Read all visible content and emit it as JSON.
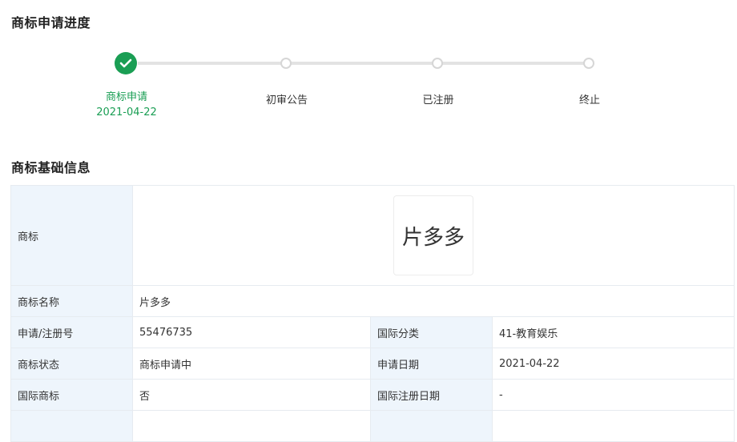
{
  "progress": {
    "title": "商标申请进度",
    "steps": [
      {
        "label": "商标申请",
        "date": "2021-04-22",
        "status": "done"
      },
      {
        "label": "初审公告",
        "date": "",
        "status": "pending"
      },
      {
        "label": "已注册",
        "date": "",
        "status": "pending"
      },
      {
        "label": "终止",
        "date": "",
        "status": "pending"
      }
    ]
  },
  "info": {
    "title": "商标基础信息",
    "trademark_label": "商标",
    "trademark_image_text": "片多多",
    "name_label": "商标名称",
    "name_value": "片多多",
    "rows": [
      {
        "k1": "申请/注册号",
        "v1": "55476735",
        "k2": "国际分类",
        "v2": "41-教育娱乐"
      },
      {
        "k1": "商标状态",
        "v1": "商标申请中",
        "k2": "申请日期",
        "v2": "2021-04-22"
      },
      {
        "k1": "国际商标",
        "v1": "否",
        "k2": "国际注册日期",
        "v2": "-"
      }
    ]
  },
  "colors": {
    "accent": "#1a9e54",
    "key_bg": "#eef5fc",
    "border": "#e6ebf0"
  }
}
